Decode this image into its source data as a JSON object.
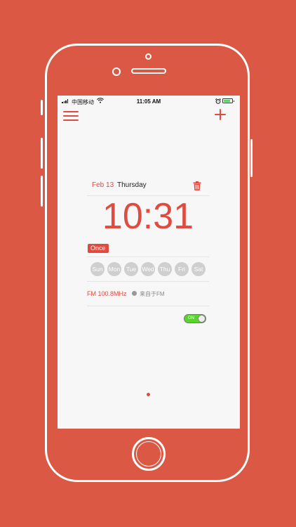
{
  "status_bar": {
    "carrier": "中国移动",
    "time": "11:05 AM"
  },
  "nav": {
    "menu_icon": "hamburger-menu-icon",
    "add_icon": "plus-icon"
  },
  "alarm": {
    "date": "Feb 13",
    "weekday": "Thursday",
    "time": "10:31",
    "repeat": "Once",
    "days": [
      "Sun",
      "Mon",
      "Tue",
      "Wed",
      "Thu",
      "Fri",
      "Sat"
    ],
    "sound": "FM 100.8MHz",
    "source": "来自于FM",
    "toggle_label": "ON",
    "enabled": true
  },
  "colors": {
    "background": "#db5944",
    "accent": "#e04a3f",
    "day_inactive": "#cfcfcf",
    "toggle_on": "#59d42c"
  }
}
